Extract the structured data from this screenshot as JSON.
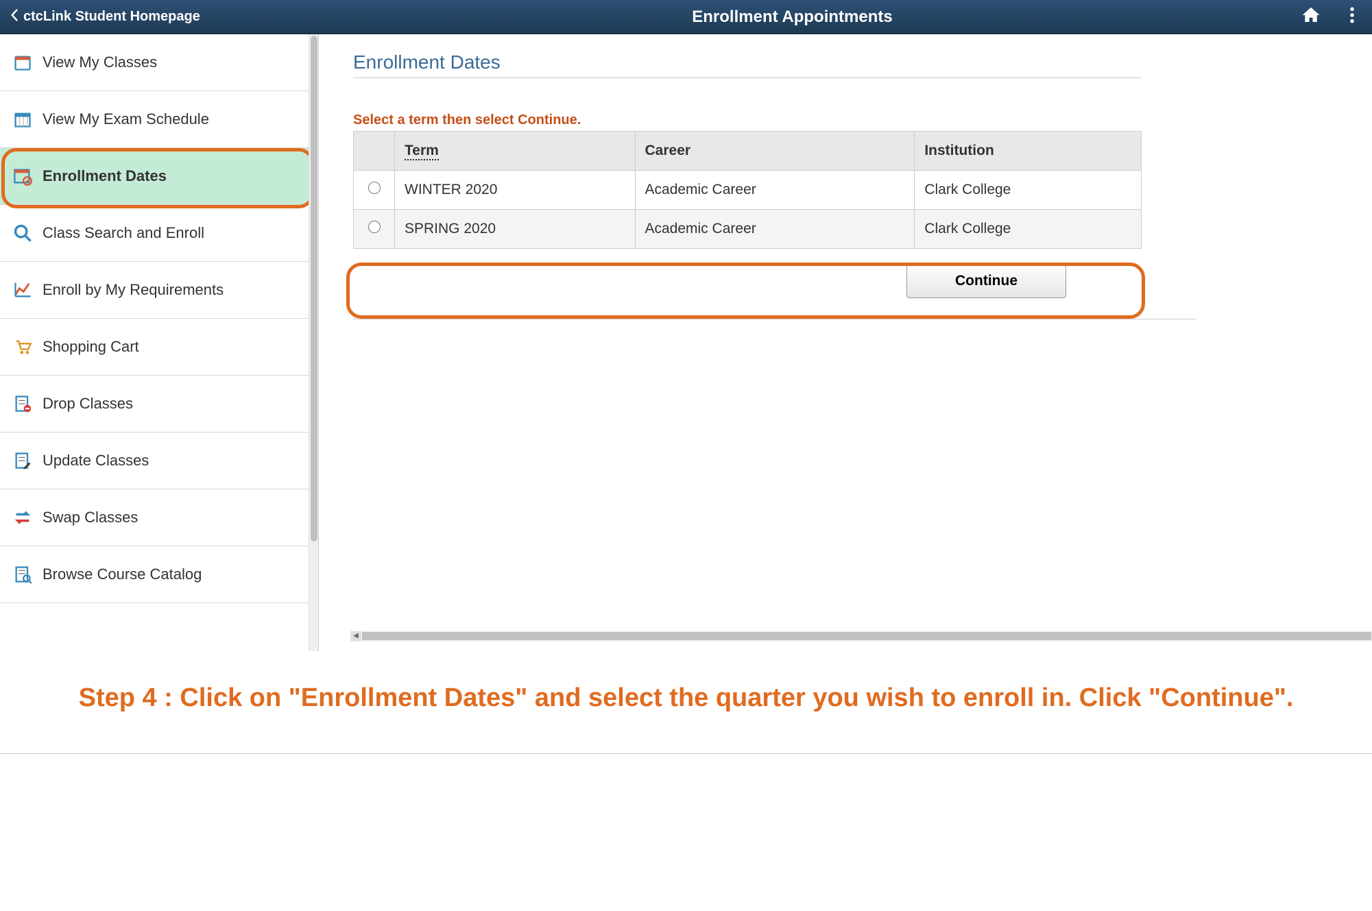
{
  "header": {
    "back_label": "ctcLink Student Homepage",
    "title": "Enrollment Appointments"
  },
  "sidebar": {
    "items": [
      {
        "label": "View My Classes",
        "icon": "calendar-icon"
      },
      {
        "label": "View My Exam Schedule",
        "icon": "calendar-grid-icon"
      },
      {
        "label": "Enrollment Dates",
        "icon": "calendar-check-icon"
      },
      {
        "label": "Class Search and Enroll",
        "icon": "search-icon"
      },
      {
        "label": "Enroll by My Requirements",
        "icon": "chart-line-icon"
      },
      {
        "label": "Shopping Cart",
        "icon": "cart-icon"
      },
      {
        "label": "Drop Classes",
        "icon": "drop-icon"
      },
      {
        "label": "Update Classes",
        "icon": "edit-icon"
      },
      {
        "label": "Swap Classes",
        "icon": "swap-icon"
      },
      {
        "label": "Browse Course Catalog",
        "icon": "catalog-icon"
      }
    ]
  },
  "main": {
    "heading": "Enrollment Dates",
    "instruction": "Select a term then select Continue.",
    "columns": {
      "term": "Term",
      "career": "Career",
      "institution": "Institution"
    },
    "rows": [
      {
        "term": "WINTER 2020",
        "career": "Academic Career",
        "institution": "Clark College"
      },
      {
        "term": "SPRING 2020",
        "career": "Academic Career",
        "institution": "Clark College"
      }
    ],
    "continue_label": "Continue"
  },
  "caption": "Step 4 : Click on \"Enrollment Dates\" and select the quarter you wish to enroll in. Click \"Continue\"."
}
